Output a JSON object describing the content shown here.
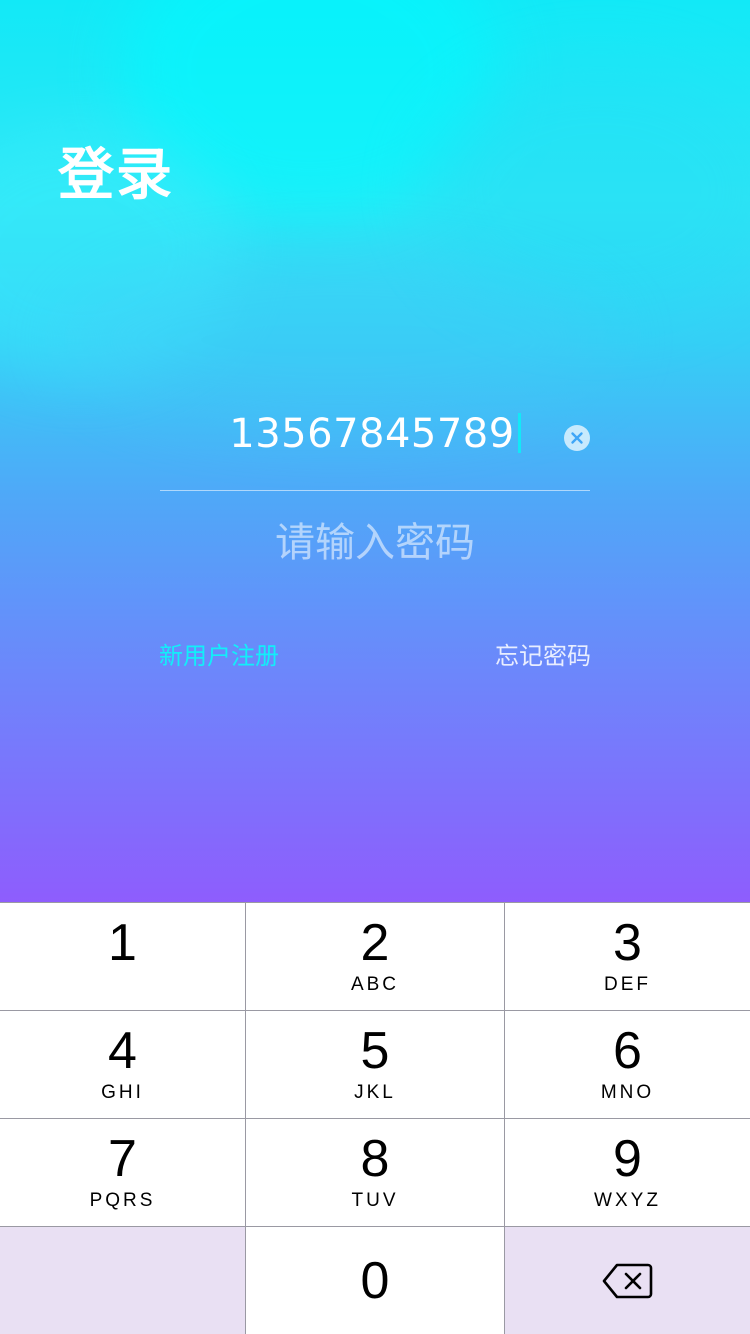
{
  "header": {
    "title": "登录"
  },
  "form": {
    "phone_value": "13567845789",
    "password_placeholder": "请输入密码",
    "register_link": "新用户注册",
    "forgot_link": "忘记密码"
  },
  "keypad": {
    "keys": [
      {
        "digit": "1",
        "letters": ""
      },
      {
        "digit": "2",
        "letters": "ABC"
      },
      {
        "digit": "3",
        "letters": "DEF"
      },
      {
        "digit": "4",
        "letters": "GHI"
      },
      {
        "digit": "5",
        "letters": "JKL"
      },
      {
        "digit": "6",
        "letters": "MNO"
      },
      {
        "digit": "7",
        "letters": "PQRS"
      },
      {
        "digit": "8",
        "letters": "TUV"
      },
      {
        "digit": "9",
        "letters": "WXYZ"
      }
    ],
    "zero": "0",
    "delete_icon": "backspace-icon",
    "clear_icon": "clear-circle-icon"
  },
  "colors": {
    "accent": "#12eef9",
    "gradient_top": "#12e9f7",
    "gradient_bottom": "#8e5dfd",
    "keypad_function_bg": "#e9e0f3"
  }
}
